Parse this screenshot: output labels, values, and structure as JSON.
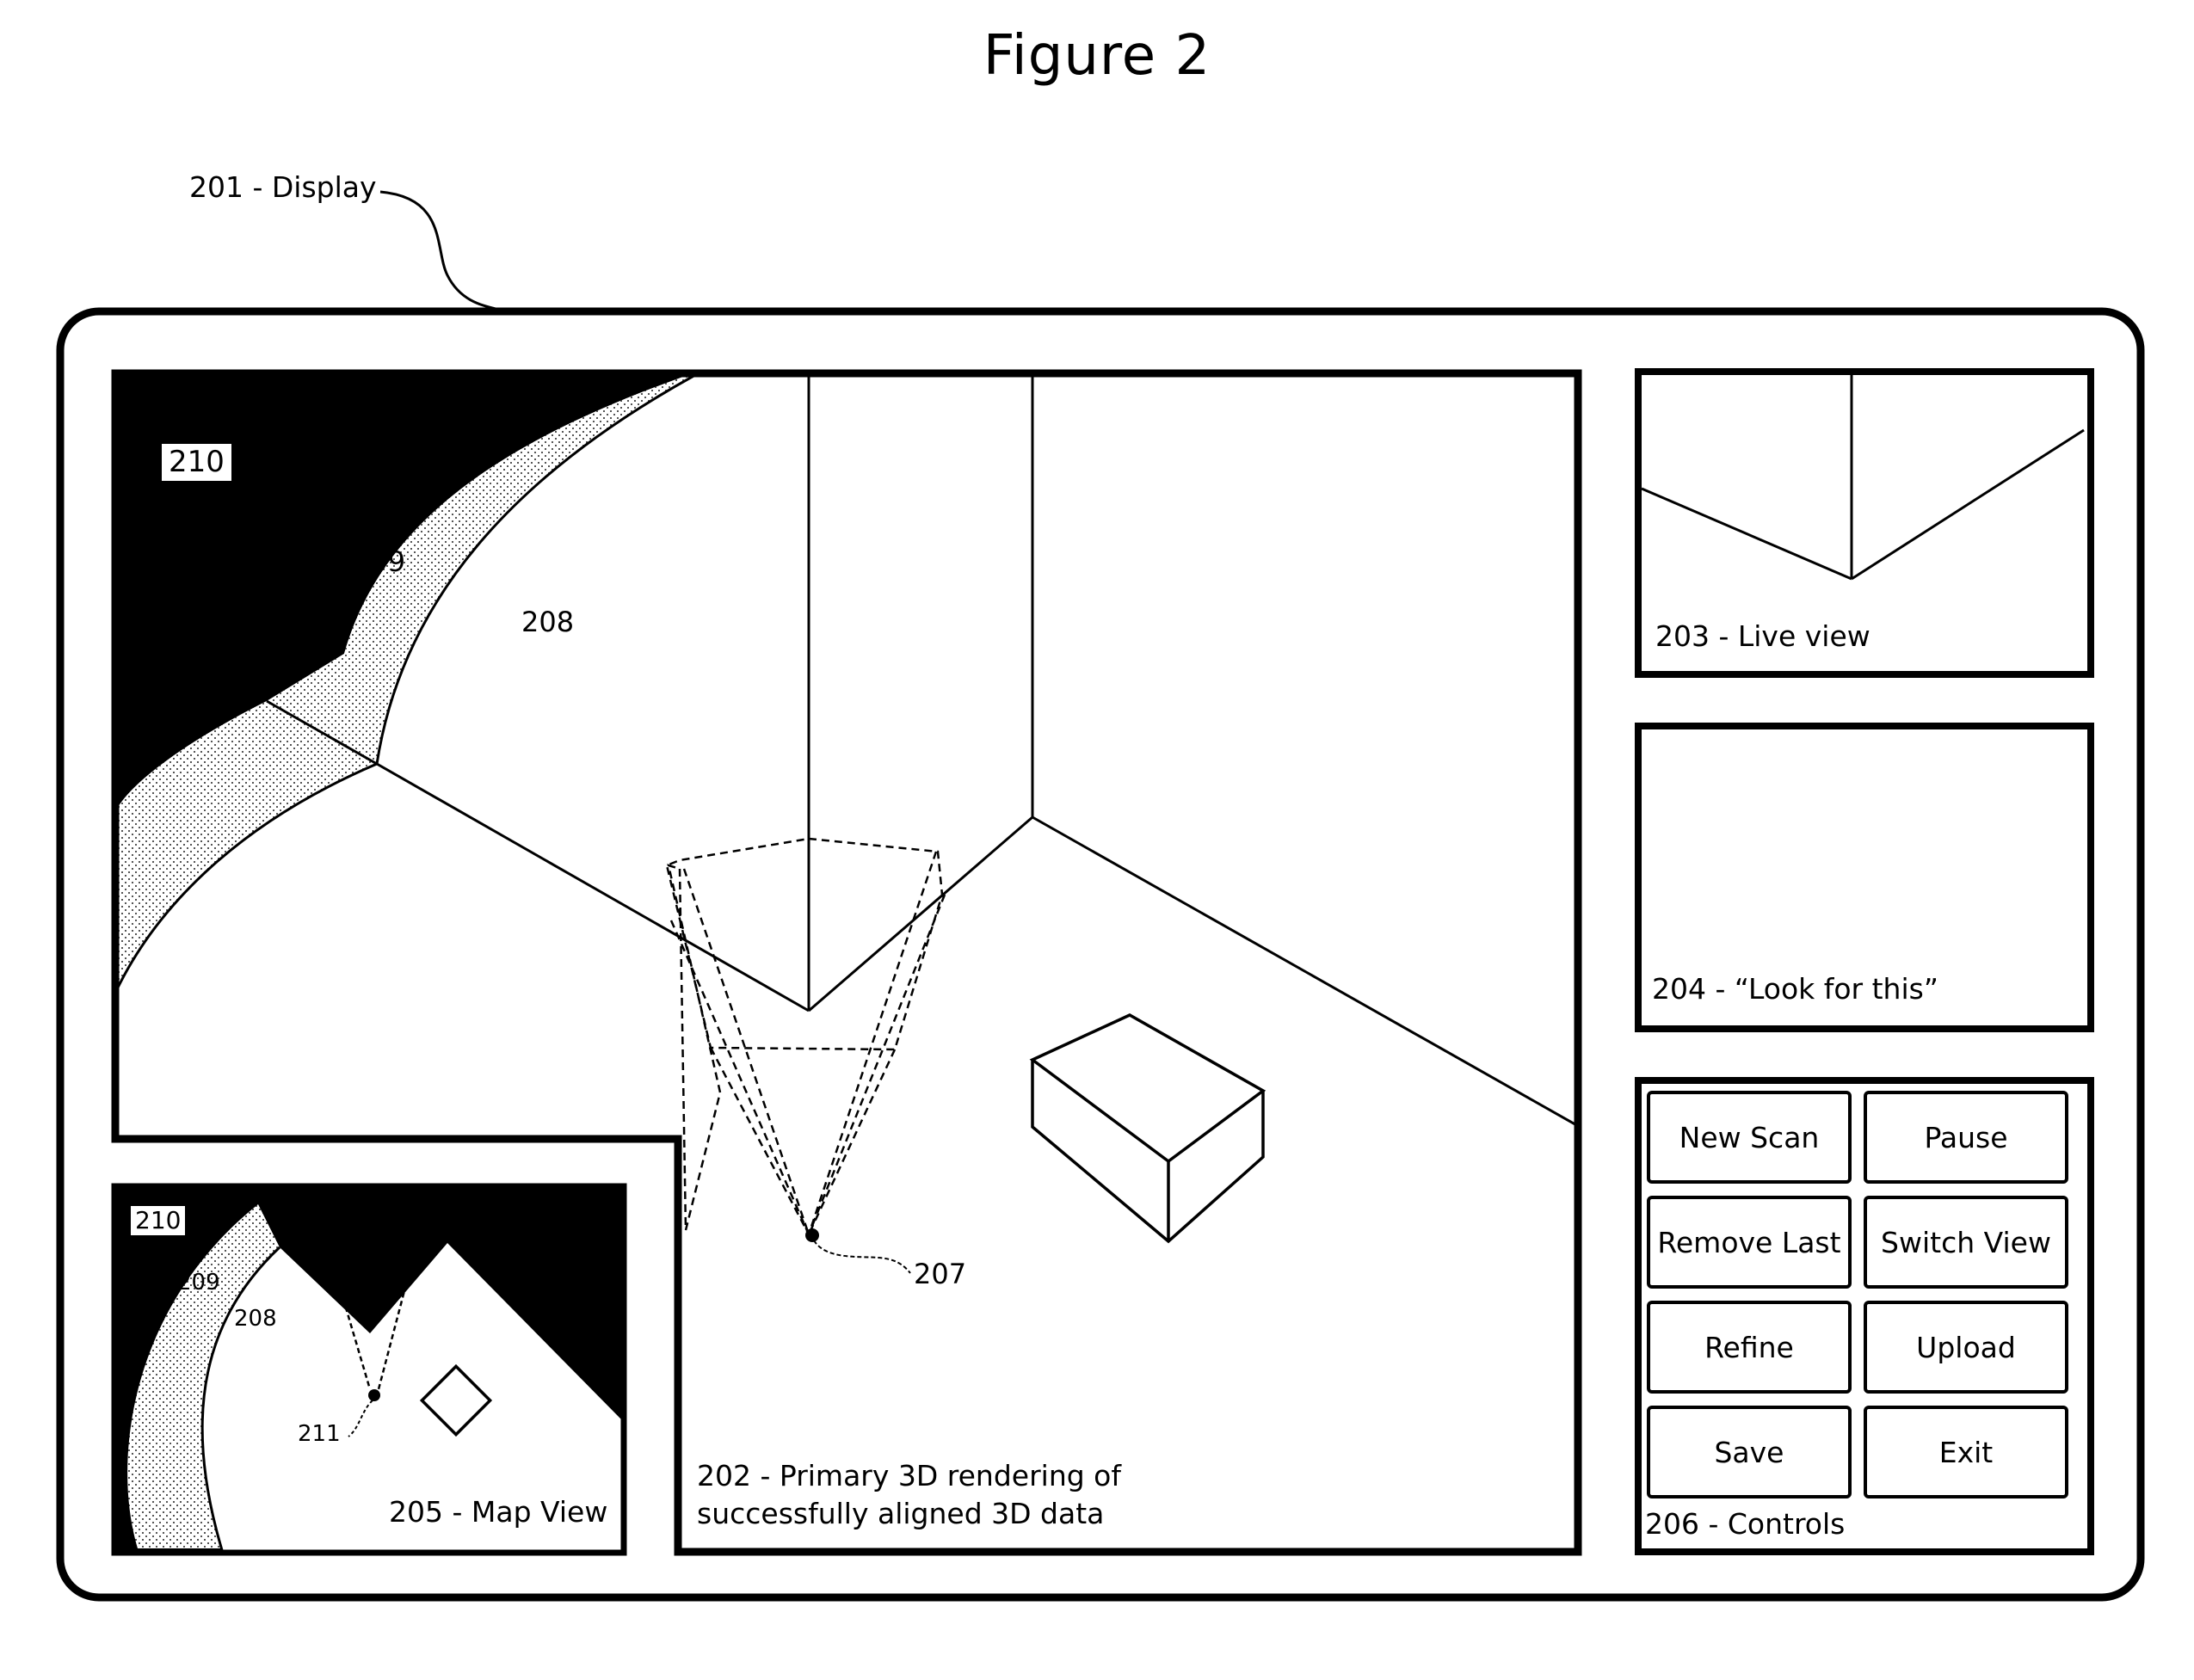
{
  "figure": {
    "title": "Figure 2"
  },
  "display": {
    "callout_label": "201 - Display"
  },
  "primary_view": {
    "caption_line1": "202 - Primary 3D rendering of",
    "caption_line2": "successfully aligned 3D data",
    "regions": {
      "unscanned": "210",
      "low_confidence": "209",
      "scanned": "208"
    },
    "camera_marker": "207"
  },
  "live_view": {
    "caption": "203 - Live view"
  },
  "look_for_this": {
    "caption": "204 - “Look for this”"
  },
  "map_view": {
    "caption": "205 - Map View",
    "regions": {
      "unscanned": "210",
      "low_confidence": "209",
      "scanned": "208"
    },
    "camera_marker": "211"
  },
  "controls": {
    "caption": "206 - Controls",
    "buttons": [
      {
        "label": "New Scan"
      },
      {
        "label": "Pause"
      },
      {
        "label": "Remove Last"
      },
      {
        "label": "Switch View"
      },
      {
        "label": "Refine"
      },
      {
        "label": "Upload"
      },
      {
        "label": "Save"
      },
      {
        "label": "Exit"
      }
    ]
  },
  "colors": {
    "ink": "#000000",
    "paper": "#ffffff",
    "stipple": "#c8c8c8"
  }
}
